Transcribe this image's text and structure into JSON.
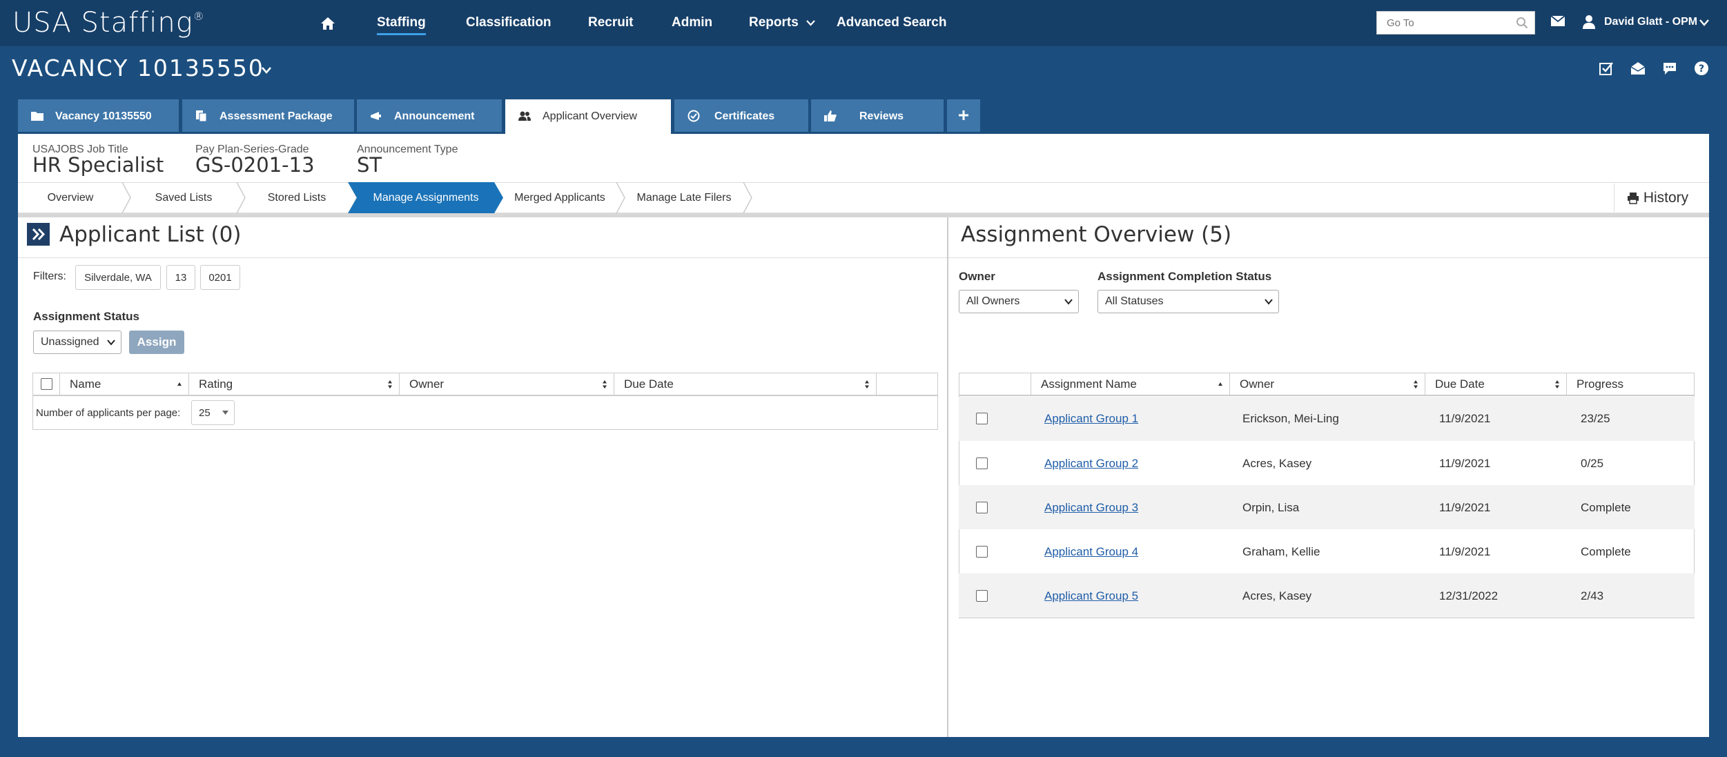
{
  "brand": {
    "name": "USA Staffing",
    "mark": "®"
  },
  "nav": {
    "items": [
      "Staffing",
      "Classification",
      "Recruit",
      "Admin",
      "Reports",
      "Advanced Search"
    ],
    "goto_placeholder": "Go To",
    "user": "David Glatt - OPM"
  },
  "vacancy": {
    "title": "VACANCY 10135550"
  },
  "tabs": [
    "Vacancy 10135550",
    "Assessment Package",
    "Announcement",
    "Applicant Overview",
    "Certificates",
    "Reviews"
  ],
  "info": {
    "job_title_label": "USAJOBS Job Title",
    "job_title": "HR Specialist",
    "grade_label": "Pay Plan-Series-Grade",
    "grade": "GS-0201-13",
    "type_label": "Announcement Type",
    "type": "ST"
  },
  "crumbs": [
    "Overview",
    "Saved Lists",
    "Stored Lists",
    "Manage Assignments",
    "Merged Applicants",
    "Manage Late Filers"
  ],
  "history_label": "History",
  "applicant_list": {
    "title": "Applicant List (0)",
    "filters_label": "Filters:",
    "filters": [
      "Silverdale, WA",
      "13",
      "0201"
    ],
    "status_label": "Assignment Status",
    "status_value": "Unassigned",
    "assign_label": "Assign",
    "columns": [
      "Name",
      "Rating",
      "Owner",
      "Due Date"
    ],
    "per_page_label": "Number of applicants per page:",
    "per_page": "25"
  },
  "assignment_overview": {
    "title": "Assignment Overview (5)",
    "owner_label": "Owner",
    "owner_value": "All Owners",
    "status_label": "Assignment Completion Status",
    "status_value": "All Statuses",
    "columns": [
      "Assignment Name",
      "Owner",
      "Due Date",
      "Progress"
    ],
    "rows": [
      {
        "name": "Applicant Group 1",
        "owner": "Erickson, Mei-Ling",
        "due": "11/9/2021",
        "progress": "23/25"
      },
      {
        "name": "Applicant Group 2",
        "owner": "Acres, Kasey",
        "due": "11/9/2021",
        "progress": "0/25"
      },
      {
        "name": "Applicant Group 3",
        "owner": "Orpin, Lisa",
        "due": "11/9/2021",
        "progress": "Complete"
      },
      {
        "name": "Applicant Group 4",
        "owner": "Graham, Kellie",
        "due": "11/9/2021",
        "progress": "Complete"
      },
      {
        "name": "Applicant Group 5",
        "owner": "Acres, Kasey",
        "due": "12/31/2022",
        "progress": "2/43"
      }
    ]
  },
  "colors": {
    "nav_bg": "#163f68",
    "page_bg": "#1b4e7e",
    "tab_bg": "#3e76a9",
    "active_crumb": "#1a73b8",
    "link": "#1f5da8"
  }
}
